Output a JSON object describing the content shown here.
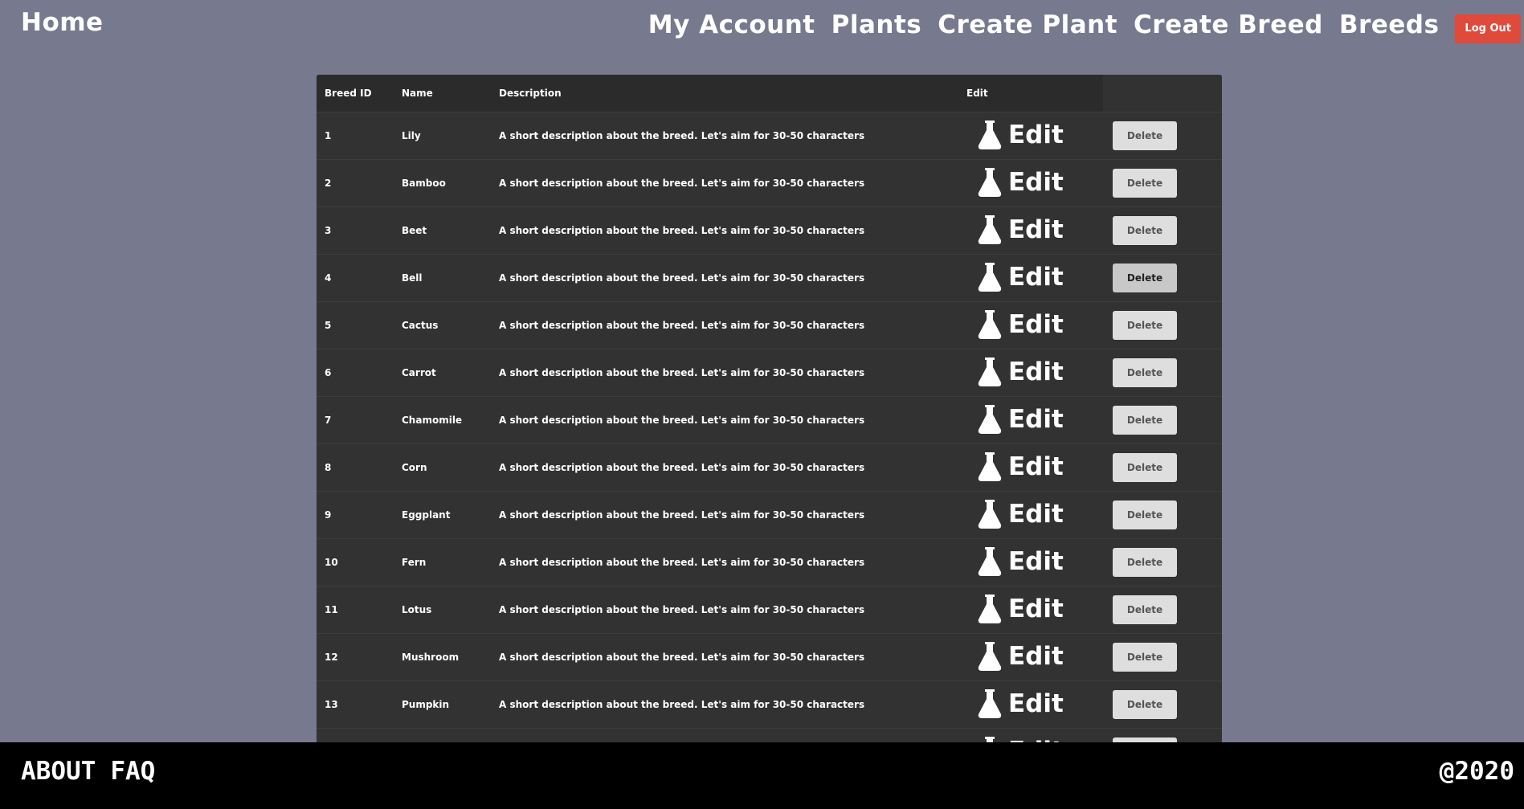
{
  "nav": {
    "home": "Home",
    "links": [
      "My Account",
      "Plants",
      "Create Plant",
      "Create Breed",
      "Breeds"
    ],
    "logout": "Log Out"
  },
  "table": {
    "headers": [
      "Breed ID",
      "Name",
      "Description",
      "Edit"
    ],
    "edit_label": "Edit",
    "delete_label": "Delete",
    "rows": [
      {
        "id": "1",
        "name": "Lily",
        "description": "A short description about the breed. Let's aim for 30-50 characters"
      },
      {
        "id": "2",
        "name": "Bamboo",
        "description": "A short description about the breed. Let's aim for 30-50 characters"
      },
      {
        "id": "3",
        "name": "Beet",
        "description": "A short description about the breed. Let's aim for 30-50 characters"
      },
      {
        "id": "4",
        "name": "Bell",
        "description": "A short description about the breed. Let's aim for 30-50 characters"
      },
      {
        "id": "5",
        "name": "Cactus",
        "description": "A short description about the breed. Let's aim for 30-50 characters"
      },
      {
        "id": "6",
        "name": "Carrot",
        "description": "A short description about the breed. Let's aim for 30-50 characters"
      },
      {
        "id": "7",
        "name": "Chamomile",
        "description": "A short description about the breed. Let's aim for 30-50 characters"
      },
      {
        "id": "8",
        "name": "Corn",
        "description": "A short description about the breed. Let's aim for 30-50 characters"
      },
      {
        "id": "9",
        "name": "Eggplant",
        "description": "A short description about the breed. Let's aim for 30-50 characters"
      },
      {
        "id": "10",
        "name": "Fern",
        "description": "A short description about the breed. Let's aim for 30-50 characters"
      },
      {
        "id": "11",
        "name": "Lotus",
        "description": "A short description about the breed. Let's aim for 30-50 characters"
      },
      {
        "id": "12",
        "name": "Mushroom",
        "description": "A short description about the breed. Let's aim for 30-50 characters"
      },
      {
        "id": "13",
        "name": "Pumpkin",
        "description": "A short description about the breed. Let's aim for 30-50 characters"
      },
      {
        "id": "",
        "name": "",
        "description": ""
      }
    ],
    "hovered_delete_row": 3
  },
  "footer": {
    "links": [
      "ABOUT",
      "FAQ"
    ],
    "copyright": "@2020"
  },
  "colors": {
    "background": "#77798f",
    "table_bg": "#323232",
    "header_bg": "#2b2b2b",
    "logout": "#e04a3a",
    "delete_btn": "#dedede",
    "footer": "#000000"
  },
  "icons": {
    "edit": "flask-icon"
  }
}
